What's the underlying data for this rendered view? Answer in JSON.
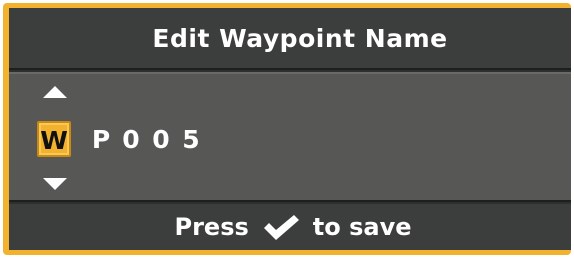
{
  "dialog": {
    "title": "Edit Waypoint Name",
    "characters": [
      "W",
      "P",
      "0",
      "0",
      "5"
    ],
    "selected_index": 0
  },
  "footer": {
    "prefix": "Press",
    "suffix": "to save",
    "icon": "checkmark-icon"
  },
  "colors": {
    "accent": "#f2b22e",
    "panel": "#2e302f",
    "editor_bg": "#575756",
    "text": "#ffffff"
  }
}
